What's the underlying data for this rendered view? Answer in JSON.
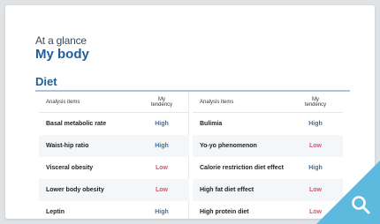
{
  "header": {
    "subtitle": "At a glance",
    "title": "My body"
  },
  "section": {
    "title": "Diet"
  },
  "table": {
    "col_item": "Analysis items",
    "col_tendency": "My tendency",
    "left": [
      {
        "item": "Basal metabolic rate",
        "tendency": "High"
      },
      {
        "item": "Waist-hip ratio",
        "tendency": "High"
      },
      {
        "item": "Visceral obesity",
        "tendency": "Low"
      },
      {
        "item": "Lower body obesity",
        "tendency": "Low"
      },
      {
        "item": "Leptin",
        "tendency": "High"
      }
    ],
    "right": [
      {
        "item": "Bulimia",
        "tendency": "High"
      },
      {
        "item": "Yo-yo phenomenon",
        "tendency": "Low"
      },
      {
        "item": "Calorie restriction diet effect",
        "tendency": "High"
      },
      {
        "item": "High fat diet effect",
        "tendency": "Low"
      },
      {
        "item": "High protein diet",
        "tendency": "Low"
      }
    ]
  },
  "colors": {
    "accent": "#1f5f9b",
    "high": "#3b73a8",
    "low": "#e0506a",
    "corner": "#5eb9de"
  },
  "icons": {
    "corner": "search-icon"
  }
}
